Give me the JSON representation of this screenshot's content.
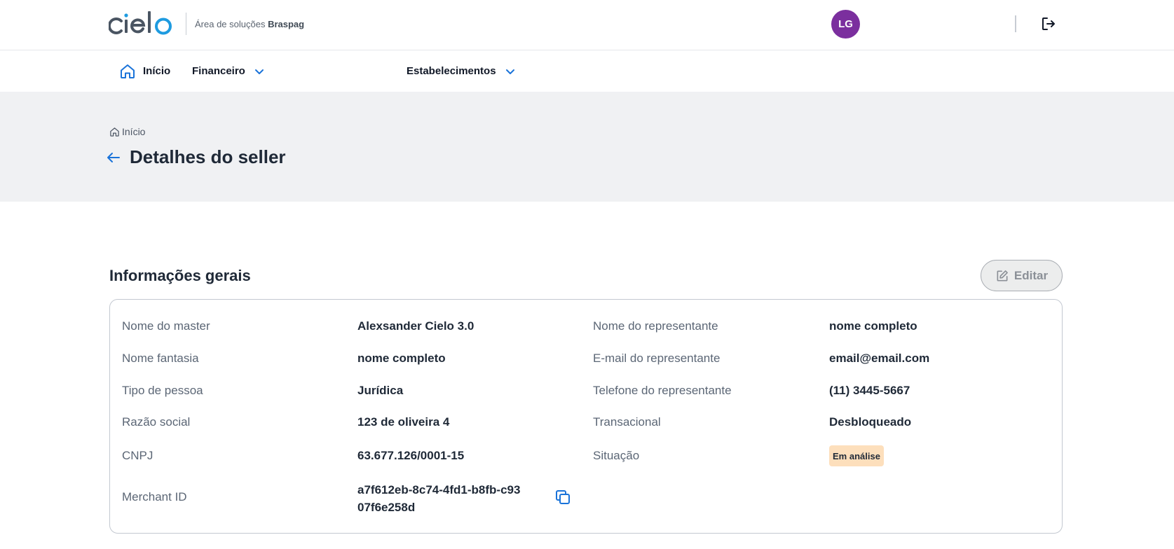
{
  "header": {
    "logo_text": "cielo",
    "area_prefix": "Área de soluções",
    "area_brand": "Braspag",
    "avatar_initials": "LG",
    "avatar_color": "#7b2f9e",
    "logout_icon": "logout-icon"
  },
  "nav": {
    "items": [
      {
        "label": "Início",
        "icon": "home-icon"
      },
      {
        "label": "Financeiro",
        "icon": "chevron-down-icon"
      },
      {
        "label": "Estabelecimentos",
        "icon": "chevron-down-icon"
      }
    ]
  },
  "page": {
    "breadcrumb": "Início",
    "title": "Detalhes do seller"
  },
  "section": {
    "title": "Informações gerais",
    "edit_label": "Editar"
  },
  "details": {
    "left": [
      {
        "label": "Nome do master",
        "value": "Alexsander Cielo 3.0"
      },
      {
        "label": "Nome fantasia",
        "value": "nome completo"
      },
      {
        "label": "Tipo de pessoa",
        "value": "Jurídica"
      },
      {
        "label": "Razão social",
        "value": "123 de oliveira 4"
      },
      {
        "label": "CNPJ",
        "value": "63.677.126/0001-15"
      },
      {
        "label": "Merchant ID",
        "value": "a7f612eb-8c74-4fd1-b8fb-c9307f6e258d"
      }
    ],
    "right": [
      {
        "label": "Nome do representante",
        "value": "nome completo"
      },
      {
        "label": "E-mail do representante",
        "value": "email@email.com"
      },
      {
        "label": "Telefone do representante",
        "value": "(11) 3445-5667"
      },
      {
        "label": "Transacional",
        "value": "Desbloqueado"
      },
      {
        "label": "Situação",
        "value": "Em análise"
      }
    ]
  },
  "colors": {
    "accent": "#1a73d9",
    "logo_dark": "#4a5562",
    "logo_blue": "#1e9be0",
    "status_badge": "#fddfbc"
  }
}
